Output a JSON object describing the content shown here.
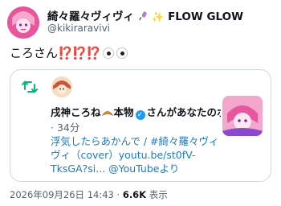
{
  "author": {
    "display_name_text": "綺々羅々ヴィヴィ",
    "display_name_suffix": "FLOW GLOW",
    "handle": "@kikiraravivi"
  },
  "post": {
    "text": "ころさん",
    "punctuation": "⁉️⁉️⁉️",
    "eye_emojis": [
      "eye",
      "eye"
    ]
  },
  "notification_card": {
    "retweet_icon": "retweet-icon",
    "name": "戌神ころね",
    "name_suffix": "本物",
    "action_text": "さんがあなたのポストをリポストしました",
    "separator": "·",
    "time_ago": "34分",
    "body_plain": "浮気したらあかんで / ",
    "body_link": "#綺々羅々ヴィヴィ（cover）youtu.be/st0fV-TksGA?si...",
    "body_tail": " @YouTubeより"
  },
  "footer": {
    "timestamp": "2026年09月26日 14:43",
    "separator": "·",
    "views_count": "6.6K",
    "views_label": "表示"
  },
  "colors": {
    "text": "#0f1419",
    "muted": "#536471",
    "retweet_green": "#00ba7c",
    "verified_blue": "#1d9bf0",
    "exclaim_red": "#d81e3c"
  }
}
